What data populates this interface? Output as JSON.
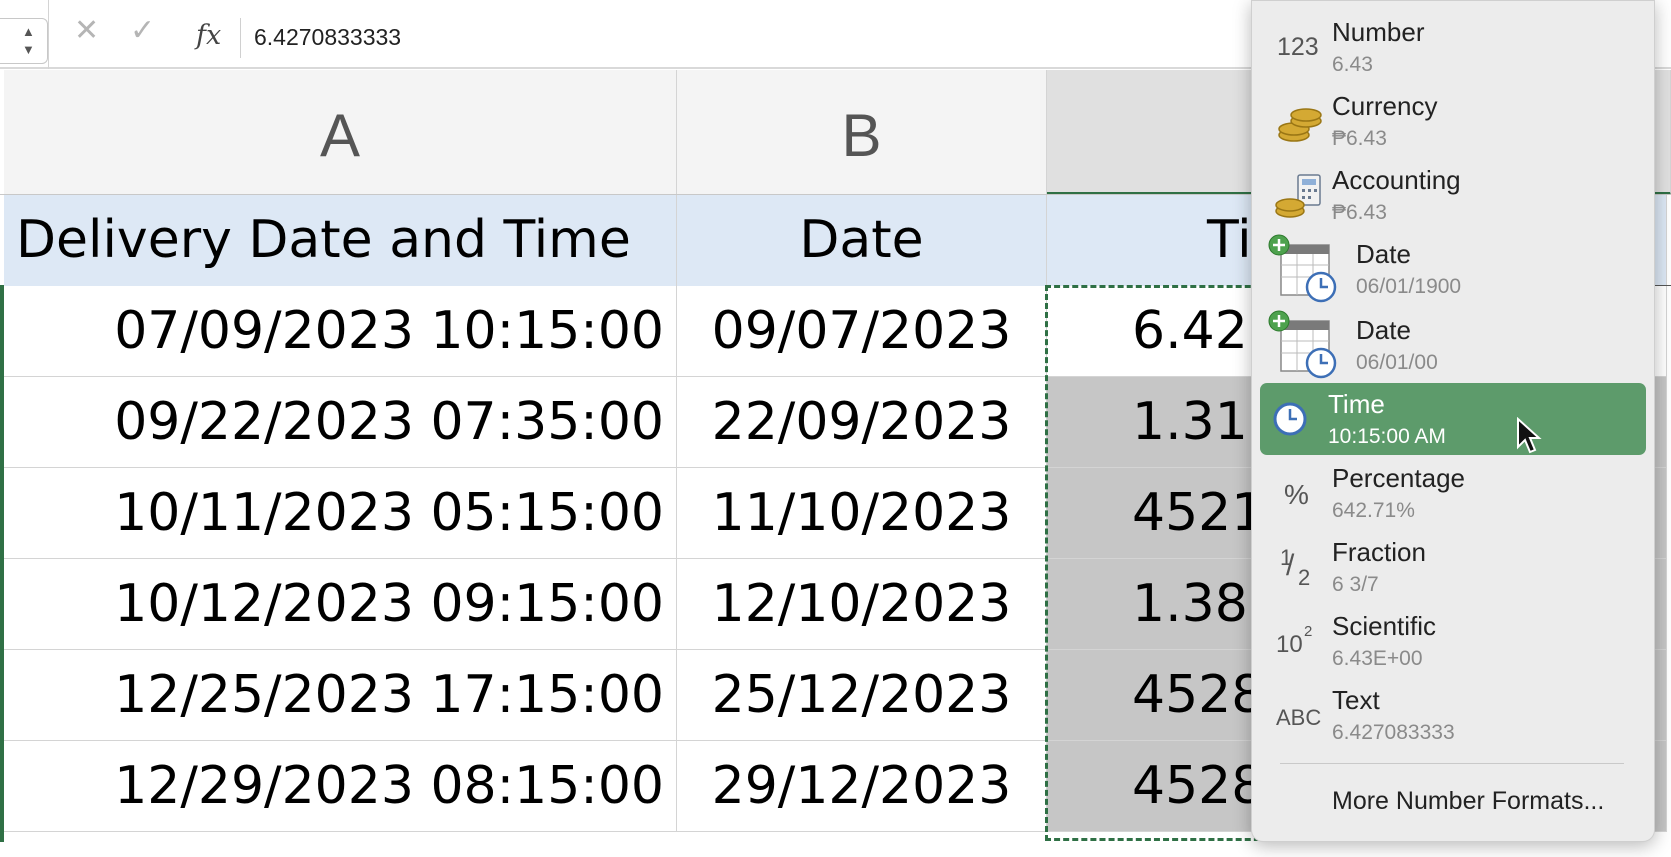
{
  "formula_bar": {
    "value": "6.4270833333",
    "fx_label": "fx",
    "cancel_glyph": "✕",
    "enter_glyph": "✓"
  },
  "columns": [
    {
      "letter": "A",
      "selected": false
    },
    {
      "letter": "B",
      "selected": false
    },
    {
      "letter": "",
      "selected": true
    }
  ],
  "header_row": {
    "a": "Delivery Date and Time",
    "b": "Date",
    "c": "Ti"
  },
  "rows": [
    {
      "a": "07/09/2023 10:15:00",
      "b": "09/07/2023",
      "c": "6.42"
    },
    {
      "a": "09/22/2023 07:35:00",
      "b": "22/09/2023",
      "c": "1.31"
    },
    {
      "a": "10/11/2023 05:15:00",
      "b": "11/10/2023",
      "c": "4521"
    },
    {
      "a": "10/12/2023 09:15:00",
      "b": "12/10/2023",
      "c": "1.38"
    },
    {
      "a": "12/25/2023 17:15:00",
      "b": "25/12/2023",
      "c": "4528"
    },
    {
      "a": "12/29/2023 08:15:00",
      "b": "29/12/2023",
      "c": "4528"
    }
  ],
  "format_menu": {
    "items": [
      {
        "label": "Number",
        "sample": "6.43",
        "icon": "number-123-icon"
      },
      {
        "label": "Currency",
        "sample": "₱6.43",
        "icon": "coins-icon"
      },
      {
        "label": "Accounting",
        "sample": "₱6.43",
        "icon": "coins-calculator-icon"
      },
      {
        "label": "Date",
        "sample": "06/01/1900",
        "icon": "calendar-clock-icon"
      },
      {
        "label": "Date",
        "sample": "06/01/00",
        "icon": "calendar-clock-icon"
      },
      {
        "label": "Time",
        "sample": "10:15:00 AM",
        "icon": "clock-icon",
        "selected": true
      },
      {
        "label": "Percentage",
        "sample": "642.71%",
        "icon": "percent-icon"
      },
      {
        "label": "Fraction",
        "sample": "6 3/7",
        "icon": "fraction-icon"
      },
      {
        "label": "Scientific",
        "sample": "6.43E+00",
        "icon": "scientific-icon"
      },
      {
        "label": "Text",
        "sample": "6.427083333",
        "icon": "abc-text-icon"
      }
    ],
    "icon_text": {
      "number": "123",
      "percent": "%",
      "scientific_base": "10",
      "scientific_exp": "2",
      "text": "ABC",
      "frac_top": "1",
      "frac_bottom": "2"
    },
    "more_label": "More Number Formats..."
  },
  "colors": {
    "selection_green": "#2f7045",
    "menu_highlight": "#5d9b6b",
    "header_fill": "#dde8f5",
    "shaded_cell": "#c6c6c6"
  }
}
